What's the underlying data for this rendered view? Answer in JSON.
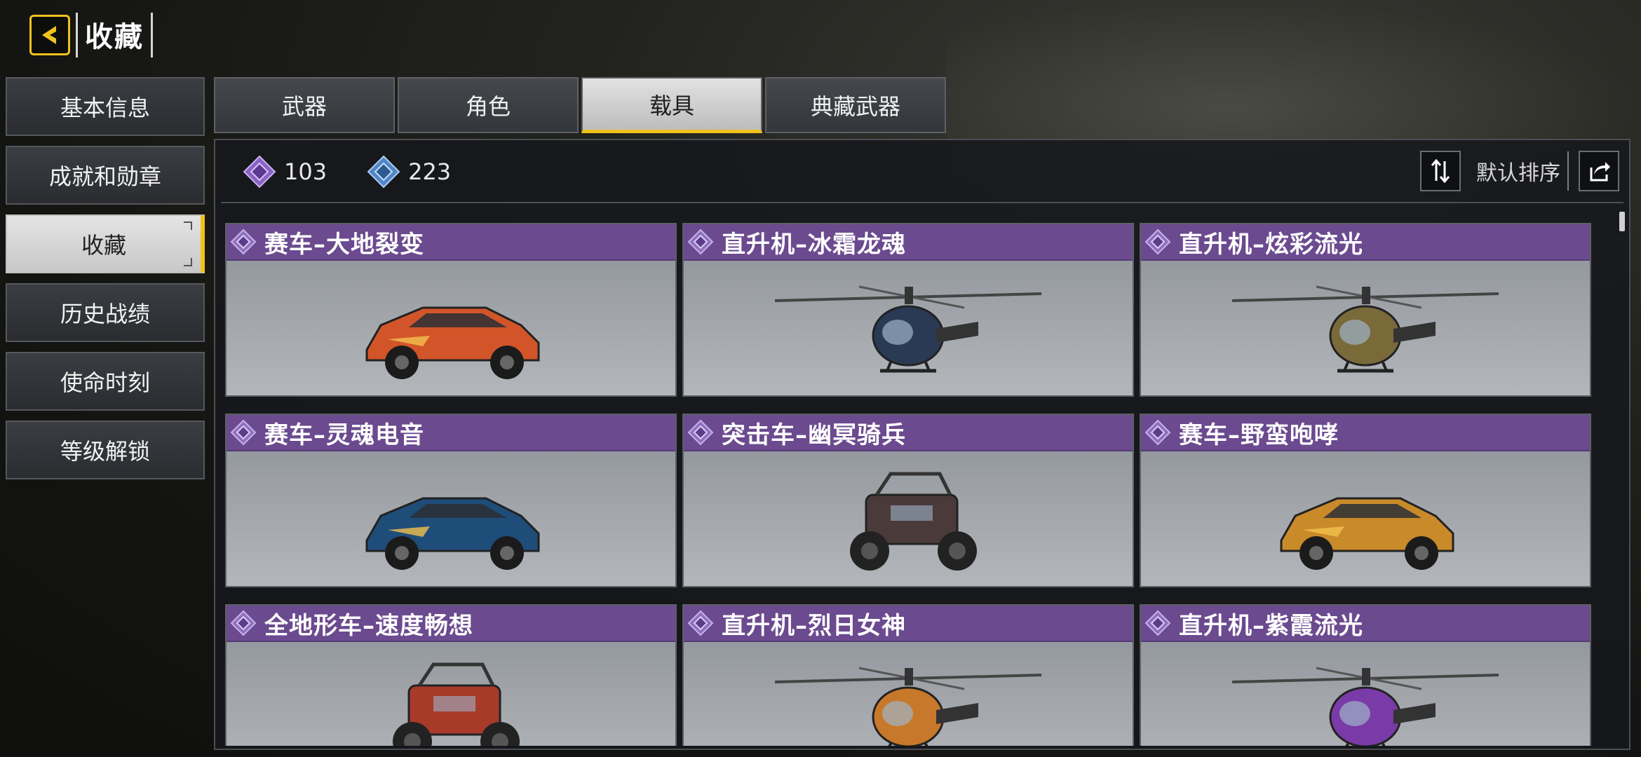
{
  "header": {
    "title": "收藏",
    "back_icon": "chevron-left-icon"
  },
  "sidebar": {
    "items": [
      {
        "label": "基本信息",
        "active": false
      },
      {
        "label": "成就和勋章",
        "active": false
      },
      {
        "label": "收藏",
        "active": true
      },
      {
        "label": "历史战绩",
        "active": false
      },
      {
        "label": "使命时刻",
        "active": false
      },
      {
        "label": "等级解锁",
        "active": false
      }
    ]
  },
  "tabs": [
    {
      "label": "武器",
      "active": false
    },
    {
      "label": "角色",
      "active": false
    },
    {
      "label": "载具",
      "active": true
    },
    {
      "label": "典藏武器",
      "active": false
    }
  ],
  "currency": [
    {
      "icon": "purple-diamond-icon",
      "value": "103",
      "color": "#8a63c6"
    },
    {
      "icon": "blue-diamond-icon",
      "value": "223",
      "color": "#4f86c9"
    }
  ],
  "toolbar": {
    "sort_label": "默认排序",
    "sort_icon": "sort-icon",
    "share_icon": "share-icon"
  },
  "colors": {
    "accent": "#f0c21c",
    "rarity_purple": "#6b4a8f"
  },
  "vehicles": [
    {
      "name": "赛车–大地裂变",
      "kind": "car",
      "color": "#d2552a"
    },
    {
      "name": "直升机–冰霜龙魂",
      "kind": "heli",
      "color": "#2a3a55"
    },
    {
      "name": "直升机–炫彩流光",
      "kind": "heli",
      "color": "#7a6a3a"
    },
    {
      "name": "赛车–灵魂电音",
      "kind": "car",
      "color": "#1f4d7a"
    },
    {
      "name": "突击车–幽冥骑兵",
      "kind": "buggy",
      "color": "#4a3a3a"
    },
    {
      "name": "赛车–野蛮咆哮",
      "kind": "car",
      "color": "#c98a2a"
    },
    {
      "name": "全地形车–速度畅想",
      "kind": "atv",
      "color": "#a83a2a"
    },
    {
      "name": "直升机–烈日女神",
      "kind": "heli",
      "color": "#c8782a"
    },
    {
      "name": "直升机–紫霞流光",
      "kind": "heli",
      "color": "#7a3aa8"
    }
  ]
}
